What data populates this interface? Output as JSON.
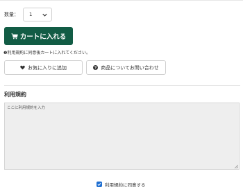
{
  "quantity": {
    "label": "数量：",
    "selected": "1"
  },
  "cart": {
    "button_label": "カートに入れる",
    "icon": "cart-icon",
    "color": "#125c45"
  },
  "notice": {
    "text": "❶利用規約に同意後カートに入れてください。"
  },
  "actions": {
    "favorite_label": "お気に入りに追加",
    "favorite_icon": "heart-icon",
    "inquiry_label": "商品についてお問い合わせ",
    "inquiry_icon": "question-circle-icon"
  },
  "terms": {
    "heading": "利用規約",
    "placeholder": "ここに利用規約を入力"
  },
  "agreement": {
    "label": "利用規約に同意する",
    "checked": true,
    "checkbox_color": "#1f6fd1"
  }
}
